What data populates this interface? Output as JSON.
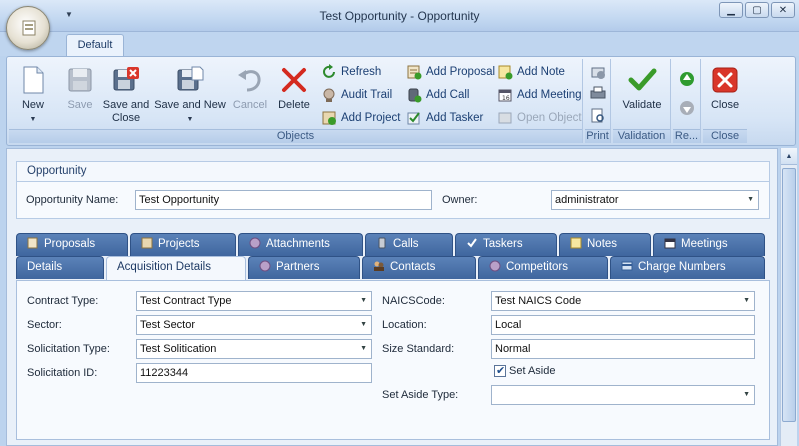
{
  "window": {
    "title": "Test Opportunity - Opportunity",
    "controls": {
      "minimize": "▁",
      "maximize": "▢",
      "close": "✕"
    }
  },
  "ribbon": {
    "tab": "Default",
    "groups": {
      "objects": "Objects",
      "print": "Print",
      "validation": "Validation",
      "refresh": "Re...",
      "close": "Close"
    },
    "buttons": {
      "new": "New",
      "save": "Save",
      "save_and_close_1": "Save and",
      "save_and_close_2": "Close",
      "save_and_new": "Save and New",
      "cancel": "Cancel",
      "delete": "Delete",
      "refresh": "Refresh",
      "audit_trail": "Audit Trail",
      "add_project": "Add Project",
      "add_proposal": "Add Proposal",
      "add_call": "Add Call",
      "add_tasker": "Add Tasker",
      "add_note": "Add Note",
      "add_meeting": "Add Meeting",
      "open_object": "Open Object",
      "validate": "Validate",
      "close": "Close"
    },
    "icons": {
      "new": "new-document-icon",
      "save": "floppy-disk-icon",
      "cancel": "undo-arrow-icon",
      "delete": "red-x-icon",
      "validate": "green-check-icon",
      "close": "close-window-icon"
    }
  },
  "opportunity": {
    "section_title": "Opportunity",
    "name_label": "Opportunity Name:",
    "name_value": "Test Opportunity",
    "owner_label": "Owner:",
    "owner_value": "administrator"
  },
  "tabs": {
    "row1": [
      "Proposals",
      "Projects",
      "Attachments",
      "Calls",
      "Taskers",
      "Notes",
      "Meetings"
    ],
    "row2": [
      "Details",
      "Acquisition Details",
      "Partners",
      "Contacts",
      "Competitors",
      "Charge Numbers"
    ],
    "active": "Acquisition Details"
  },
  "acquisition": {
    "contract_type_label": "Contract Type:",
    "contract_type_value": "Test Contract Type",
    "sector_label": "Sector:",
    "sector_value": "Test Sector",
    "solicitation_type_label": "Solicitation Type:",
    "solicitation_type_value": "Test Solitication",
    "solicitation_id_label": "Solicitation ID:",
    "solicitation_id_value": "11223344",
    "naics_label": "NAICSCode:",
    "naics_value": "Test NAICS Code",
    "location_label": "Location:",
    "location_value": "Local",
    "size_standard_label": "Size Standard:",
    "size_standard_value": "Normal",
    "set_aside_label": "Set Aside",
    "set_aside_checked": true,
    "set_aside_type_label": "Set Aside Type:",
    "set_aside_type_value": ""
  },
  "colors": {
    "tab_inactive": "#4a71a8",
    "ribbon_text": "#1b3f73",
    "delete_red": "#d42a1f",
    "validate_green": "#3a9b2a"
  }
}
